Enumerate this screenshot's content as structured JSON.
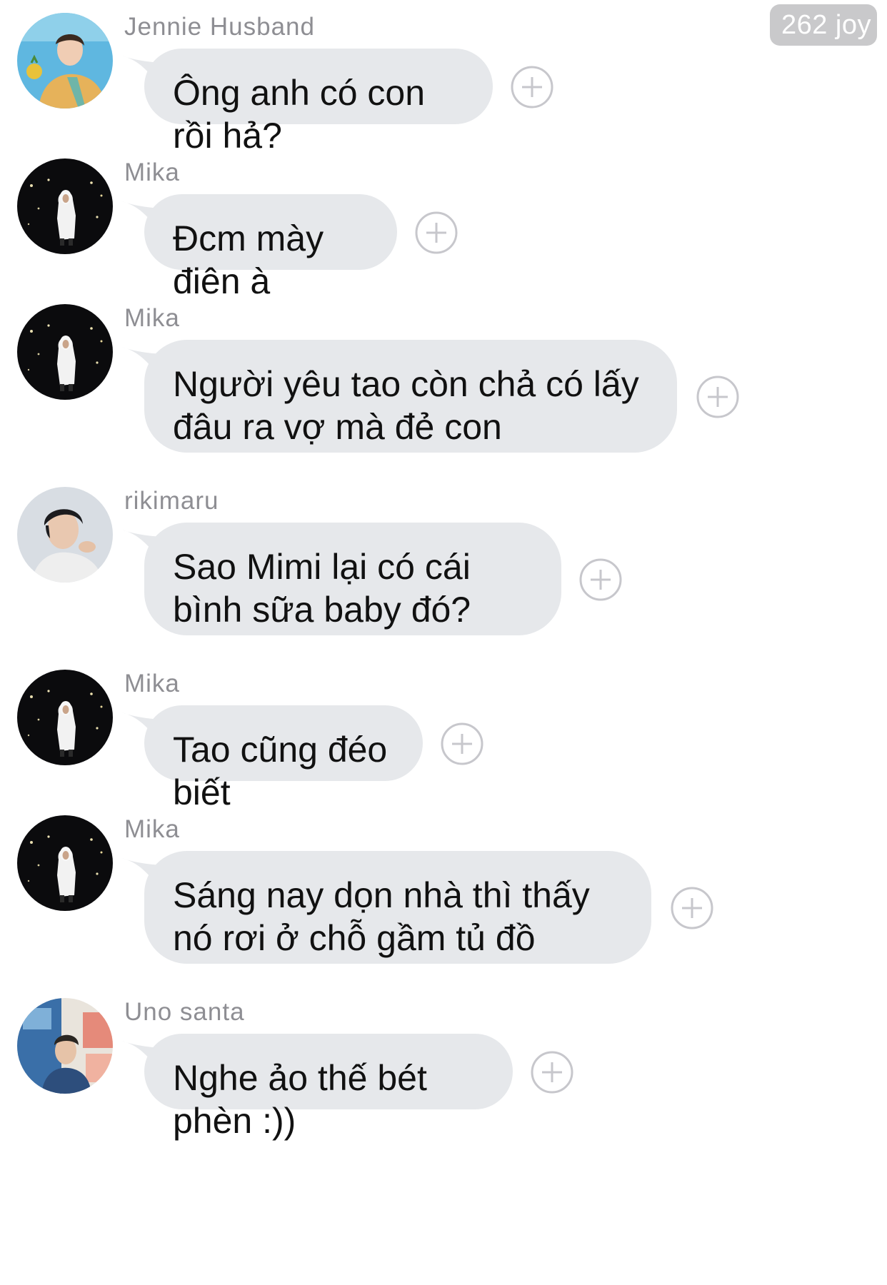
{
  "joy_badge": "262 joy",
  "messages": [
    {
      "sender": "Jennie Husband",
      "text": "Ông anh có con rồi hả?",
      "avatar": "photo-man-pool"
    },
    {
      "sender": "Mika",
      "text": "Đcm mày điên à",
      "avatar": "photo-man-hoodie-night"
    },
    {
      "sender": "Mika",
      "text": "Người yêu tao còn chả có lấy đâu ra vợ mà đẻ con",
      "avatar": "photo-man-hoodie-night"
    },
    {
      "sender": "rikimaru",
      "text": "Sao Mimi lại có cái bình sữa baby đó?",
      "avatar": "photo-man-portrait"
    },
    {
      "sender": "Mika",
      "text": "Tao cũng đéo biết",
      "avatar": "photo-man-hoodie-night"
    },
    {
      "sender": "Mika",
      "text": "Sáng nay dọn nhà thì thấy nó rơi ở chỗ gầm tủ đồ",
      "avatar": "photo-man-hoodie-night"
    },
    {
      "sender": "Uno santa",
      "text": "Nghe ảo thế bét phèn :))",
      "avatar": "photo-man-art-wall"
    }
  ],
  "colors": {
    "bubble": "#e6e8eb",
    "sender_text": "#8e8e93",
    "plus_icon": "#c7c7cc",
    "badge": "#c9c9cb"
  }
}
